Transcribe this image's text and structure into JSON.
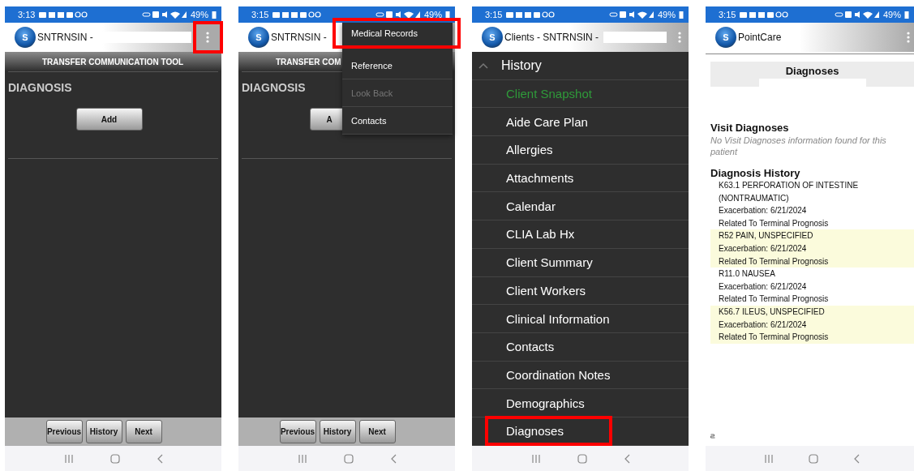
{
  "screens": [
    {
      "kind": "form",
      "status_bar": {
        "time": "3:13",
        "battery": "49%"
      },
      "app_bar": {
        "logo": "S",
        "title": "SNTRNSIN -",
        "redacted": true,
        "menu_button": {
          "highlighted": true
        }
      },
      "toolbar_title": "TRANSFER COMMUNICATION TOOL",
      "section_title": "DIAGNOSIS",
      "add_button": "Add",
      "footer_buttons": [
        "Previous",
        "History",
        "Next"
      ]
    },
    {
      "kind": "form",
      "status_bar": {
        "time": "3:15",
        "battery": "49%"
      },
      "app_bar": {
        "logo": "S",
        "title": "SNTRNSIN -"
      },
      "toolbar_title": "TRANSFER COM",
      "section_title": "DIAGNOSIS",
      "add_button": "A",
      "footer_buttons": [
        "Previous",
        "History",
        "Next"
      ],
      "overflow_menu": [
        {
          "label": "Medical Records",
          "disabled": false,
          "highlighted": true
        },
        {
          "label": "Reference",
          "disabled": false,
          "highlighted": false
        },
        {
          "label": "Look Back",
          "disabled": true,
          "highlighted": false
        },
        {
          "label": "Contacts",
          "disabled": false,
          "highlighted": false
        }
      ]
    },
    {
      "kind": "menu",
      "status_bar": {
        "time": "3:15",
        "battery": "49%"
      },
      "app_bar": {
        "logo": "S",
        "title": "Clients - SNTRNSIN -",
        "redacted": true,
        "menu_button": {
          "highlighted": false
        }
      },
      "group": {
        "label": "History",
        "expanded": true,
        "items": [
          {
            "label": "Client Snapshot",
            "selected": true,
            "highlighted": false
          },
          {
            "label": "Aide Care Plan",
            "selected": false,
            "highlighted": false
          },
          {
            "label": "Allergies",
            "selected": false,
            "highlighted": false
          },
          {
            "label": "Attachments",
            "selected": false,
            "highlighted": false
          },
          {
            "label": "Calendar",
            "selected": false,
            "highlighted": false
          },
          {
            "label": "CLIA Lab Hx",
            "selected": false,
            "highlighted": false
          },
          {
            "label": "Client Summary",
            "selected": false,
            "highlighted": false
          },
          {
            "label": "Client Workers",
            "selected": false,
            "highlighted": false
          },
          {
            "label": "Clinical Information",
            "selected": false,
            "highlighted": false
          },
          {
            "label": "Contacts",
            "selected": false,
            "highlighted": false
          },
          {
            "label": "Coordination Notes",
            "selected": false,
            "highlighted": false
          },
          {
            "label": "Demographics",
            "selected": false,
            "highlighted": false
          },
          {
            "label": "Diagnoses",
            "selected": false,
            "highlighted": true
          }
        ]
      }
    },
    {
      "kind": "report",
      "status_bar": {
        "time": "3:15",
        "battery": "49%"
      },
      "app_bar": {
        "logo": "S",
        "title": "PointCare",
        "redacted": false,
        "menu_button": {
          "highlighted": false
        }
      },
      "heading": "Diagnoses",
      "heading_redacted": true,
      "visit_title": "Visit Diagnoses",
      "visit_note": "No Visit Diagnoses information found for this patient",
      "history_title": "Diagnosis History",
      "entries": [
        {
          "shaded": false,
          "lines": [
            "K63.1 PERFORATION OF INTESTINE (NONTRAUMATIC)",
            "Exacerbation: 6/21/2024",
            "Related To Terminal Prognosis"
          ]
        },
        {
          "shaded": true,
          "lines": [
            "R52 PAIN, UNSPECIFIED",
            "Exacerbation: 6/21/2024",
            "Related To Terminal Prognosis"
          ]
        },
        {
          "shaded": false,
          "lines": [
            "R11.0 NAUSEA",
            "Exacerbation: 6/21/2024",
            "Related To Terminal Prognosis"
          ]
        },
        {
          "shaded": true,
          "lines": [
            "K56.7 ILEUS, UNSPECIFIED",
            "Exacerbation: 6/21/2024",
            "Related To Terminal Prognosis"
          ]
        }
      ]
    }
  ]
}
